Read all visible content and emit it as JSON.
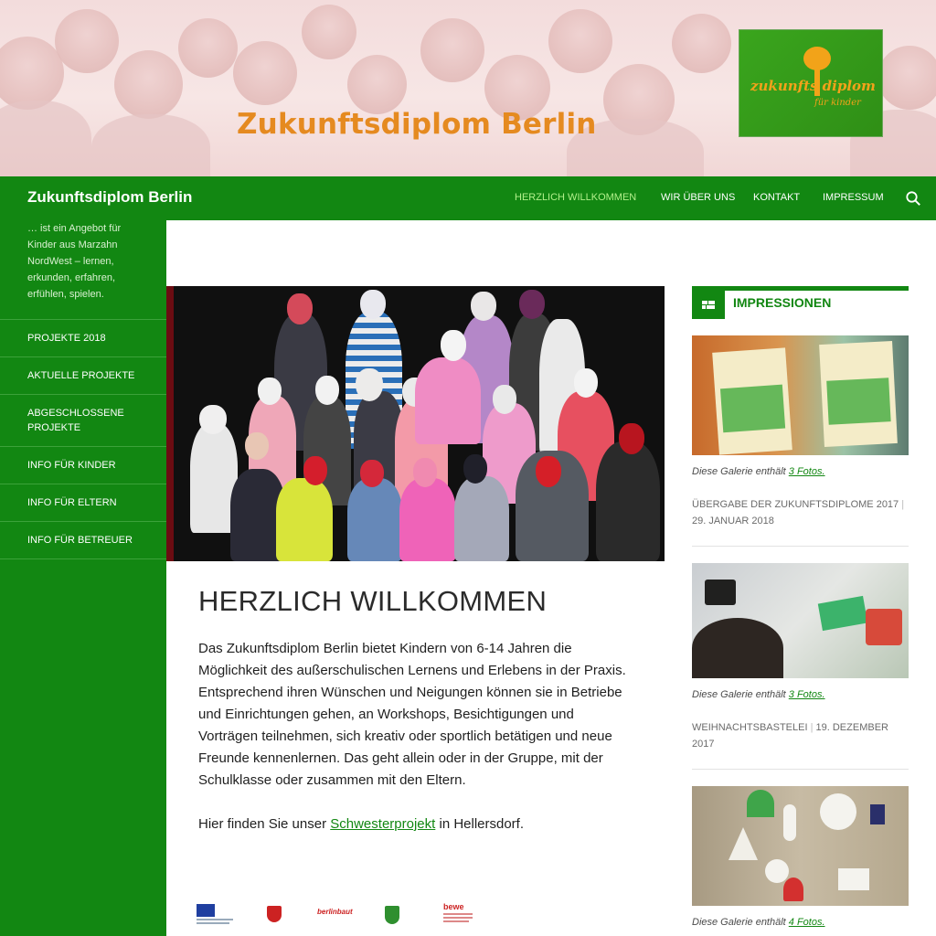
{
  "banner": {
    "title": "Zukunftsdiplom Berlin",
    "logo_text": "zukunfts diplom",
    "logo_subtext": "für kinder"
  },
  "navbar": {
    "site_title": "Zukunftsdiplom Berlin",
    "items": [
      {
        "label": "HERZLICH WILLKOMMEN",
        "active": true
      },
      {
        "label": "WIR ÜBER UNS",
        "active": false
      },
      {
        "label": "KONTAKT",
        "active": false
      },
      {
        "label": "IMPRESSUM",
        "active": false
      }
    ],
    "search_icon": "search-icon"
  },
  "sidebar": {
    "tagline": "… ist ein Angebot für Kinder aus Marzahn NordWest – lernen, erkunden, erfahren, erfühlen, spielen.",
    "items": [
      {
        "label": "PROJEKTE 2018"
      },
      {
        "label": "AKTUELLE PROJEKTE"
      },
      {
        "label": "ABGESCHLOSSENE PROJEKTE"
      },
      {
        "label": "INFO FÜR KINDER"
      },
      {
        "label": "INFO FÜR ELTERN"
      },
      {
        "label": "INFO FÜR BETREUER"
      }
    ]
  },
  "main": {
    "title": "HERZLICH WILLKOMMEN",
    "intro": "Das Zukunftsdiplom Berlin bietet Kindern von 6-14 Jahren die Möglichkeit des außerschulischen Lernens und Erlebens in der Praxis. Entsprechend ihren Wünschen und Neigungen können sie in Betriebe und Einrichtungen gehen, an Workshops, Besichtigungen und Vorträgen teilnehmen, sich kreativ oder sportlich betätigen und neue Freunde kennenlernen. Das geht allein oder in der Gruppe, mit der Schulklasse oder zusammen mit den Eltern.",
    "sister_prefix": "Hier finden Sie unser ",
    "sister_link": "Schwesterprojekt",
    "sister_suffix": " in Hellersdorf."
  },
  "partner_logos": {
    "berlinbaut": "berlinbaut",
    "bewe": "bewe"
  },
  "widget": {
    "title": "IMPRESSIONEN",
    "icon": "gallery-icon",
    "galleries": [
      {
        "caption_prefix": "Diese Galerie enthält ",
        "caption_link": "3 Fotos.",
        "title": "ÜBERGABE DER ZUKUNFTSDIPLOME 2017",
        "date": "29. JANUAR 2018"
      },
      {
        "caption_prefix": "Diese Galerie enthält ",
        "caption_link": "3 Fotos.",
        "title": "WEIHNACHTSBASTELEI",
        "date": "19. DEZEMBER 2017"
      },
      {
        "caption_prefix": "Diese Galerie enthält ",
        "caption_link": "4 Fotos."
      }
    ]
  },
  "colors": {
    "brand_green": "#128712",
    "active_nav": "#b2f08b",
    "banner_orange": "#e58a20"
  }
}
